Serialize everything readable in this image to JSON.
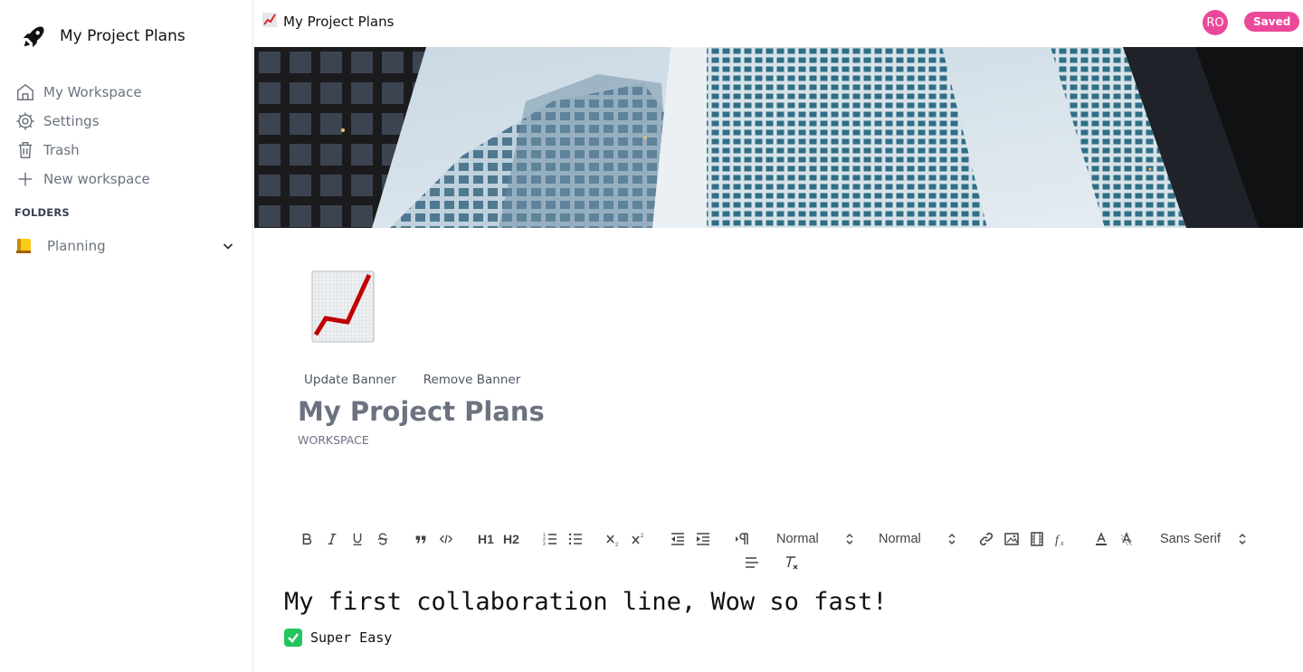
{
  "app": {
    "name": "My Project Plans"
  },
  "sidebar": {
    "items": [
      {
        "label": "My Workspace",
        "icon": "home-icon"
      },
      {
        "label": "Settings",
        "icon": "settings-icon"
      },
      {
        "label": "Trash",
        "icon": "trash-icon"
      },
      {
        "label": "New workspace",
        "icon": "plus-icon"
      }
    ],
    "folders_label": "FOLDERS",
    "folders": [
      {
        "name": "Planning",
        "icon": "yellow-notebook-icon"
      }
    ]
  },
  "topbar": {
    "breadcrumb": "My Project Plans",
    "avatar_initials": "RO",
    "status": "Saved"
  },
  "page": {
    "update_banner": "Update Banner",
    "remove_banner": "Remove Banner",
    "title": "My Project Plans",
    "subtitle": "WORKSPACE"
  },
  "toolbar": {
    "header_select": "Normal",
    "size_select": "Normal",
    "font_select": "Sans Serif",
    "h1": "H1",
    "h2": "H2"
  },
  "editor": {
    "line1": "My first collaboration line, Wow so fast!",
    "line2": "Super Easy"
  },
  "colors": {
    "accent": "#ec4899",
    "muted": "#6b7280",
    "check": "#22c55e"
  }
}
